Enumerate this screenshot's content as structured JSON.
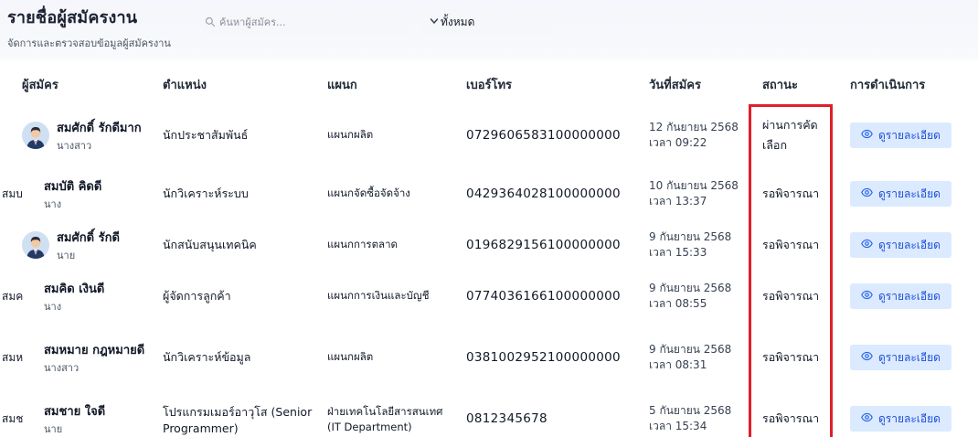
{
  "header": {
    "title": "รายชื่อผู้สมัครงาน",
    "subtitle": "จัดการและตรวจสอบข้อมูลผู้สมัครงาน"
  },
  "search": {
    "placeholder": "ค้นหาผู้สมัคร..."
  },
  "filter": {
    "selected": "ทั้งหมด"
  },
  "table": {
    "headers": [
      "ผู้สมัคร",
      "ตำแหน่ง",
      "แผนก",
      "เบอร์โทร",
      "วันที่สมัคร",
      "สถานะ",
      "การดำเนินการ"
    ],
    "action_label": "ดูรายละเอียด",
    "rows": [
      {
        "avatar": "photo",
        "initials": "",
        "name": "สมศักดิ์ รักดีมาก",
        "title": "นางสาว",
        "position": "นักประชาสัมพันธ์",
        "department": "แผนกผลิต",
        "phone": "0729606583100000000",
        "date": "12 กันยายน 2568",
        "time": "เวลา 09:22",
        "status": "ผ่านการคัดเลือก"
      },
      {
        "avatar": "text",
        "initials": "สมบ",
        "name": "สมบัติ คิดดี",
        "title": "นาง",
        "position": "นักวิเคราะห์ระบบ",
        "department": "แผนกจัดซื้อจัดจ้าง",
        "phone": "0429364028100000000",
        "date": "10 กันยายน 2568",
        "time": "เวลา 13:37",
        "status": "รอพิจารณา"
      },
      {
        "avatar": "photo",
        "initials": "",
        "name": "สมศักดิ์ รักดี",
        "title": "นาย",
        "position": "นักสนับสนุนเทคนิค",
        "department": "แผนกการตลาด",
        "phone": "0196829156100000000",
        "date": "9 กันยายน 2568",
        "time": "เวลา 15:33",
        "status": "รอพิจารณา"
      },
      {
        "avatar": "text",
        "initials": "สมค",
        "name": "สมคิด เงินดี",
        "title": "นาง",
        "position": "ผู้จัดการลูกค้า",
        "department": "แผนกการเงินและบัญชี",
        "phone": "0774036166100000000",
        "date": "9 กันยายน 2568",
        "time": "เวลา 08:55",
        "status": "รอพิจารณา"
      },
      {
        "avatar": "text",
        "initials": "สมห",
        "name": "สมหมาย กฎหมายดี",
        "title": "นางสาว",
        "position": "นักวิเคราะห์ข้อมูล",
        "department": "แผนกผลิต",
        "phone": "0381002952100000000",
        "date": "9 กันยายน 2568",
        "time": "เวลา 08:31",
        "status": "รอพิจารณา"
      },
      {
        "avatar": "text",
        "initials": "สมช",
        "name": "สมชาย ใจดี",
        "title": "นาย",
        "position": "โปรแกรมเมอร์อาวุโส (Senior Programmer)",
        "department": "ฝ่ายเทคโนโลยีสารสนเทศ (IT Department)",
        "phone": "0812345678",
        "date": "5 กันยายน 2568",
        "time": "เวลา 15:34",
        "status": "รอพิจารณา"
      }
    ]
  },
  "colors": {
    "accent": "#1d4ed8",
    "button_bg": "#dbeafe",
    "highlight": "#e01e2b"
  }
}
